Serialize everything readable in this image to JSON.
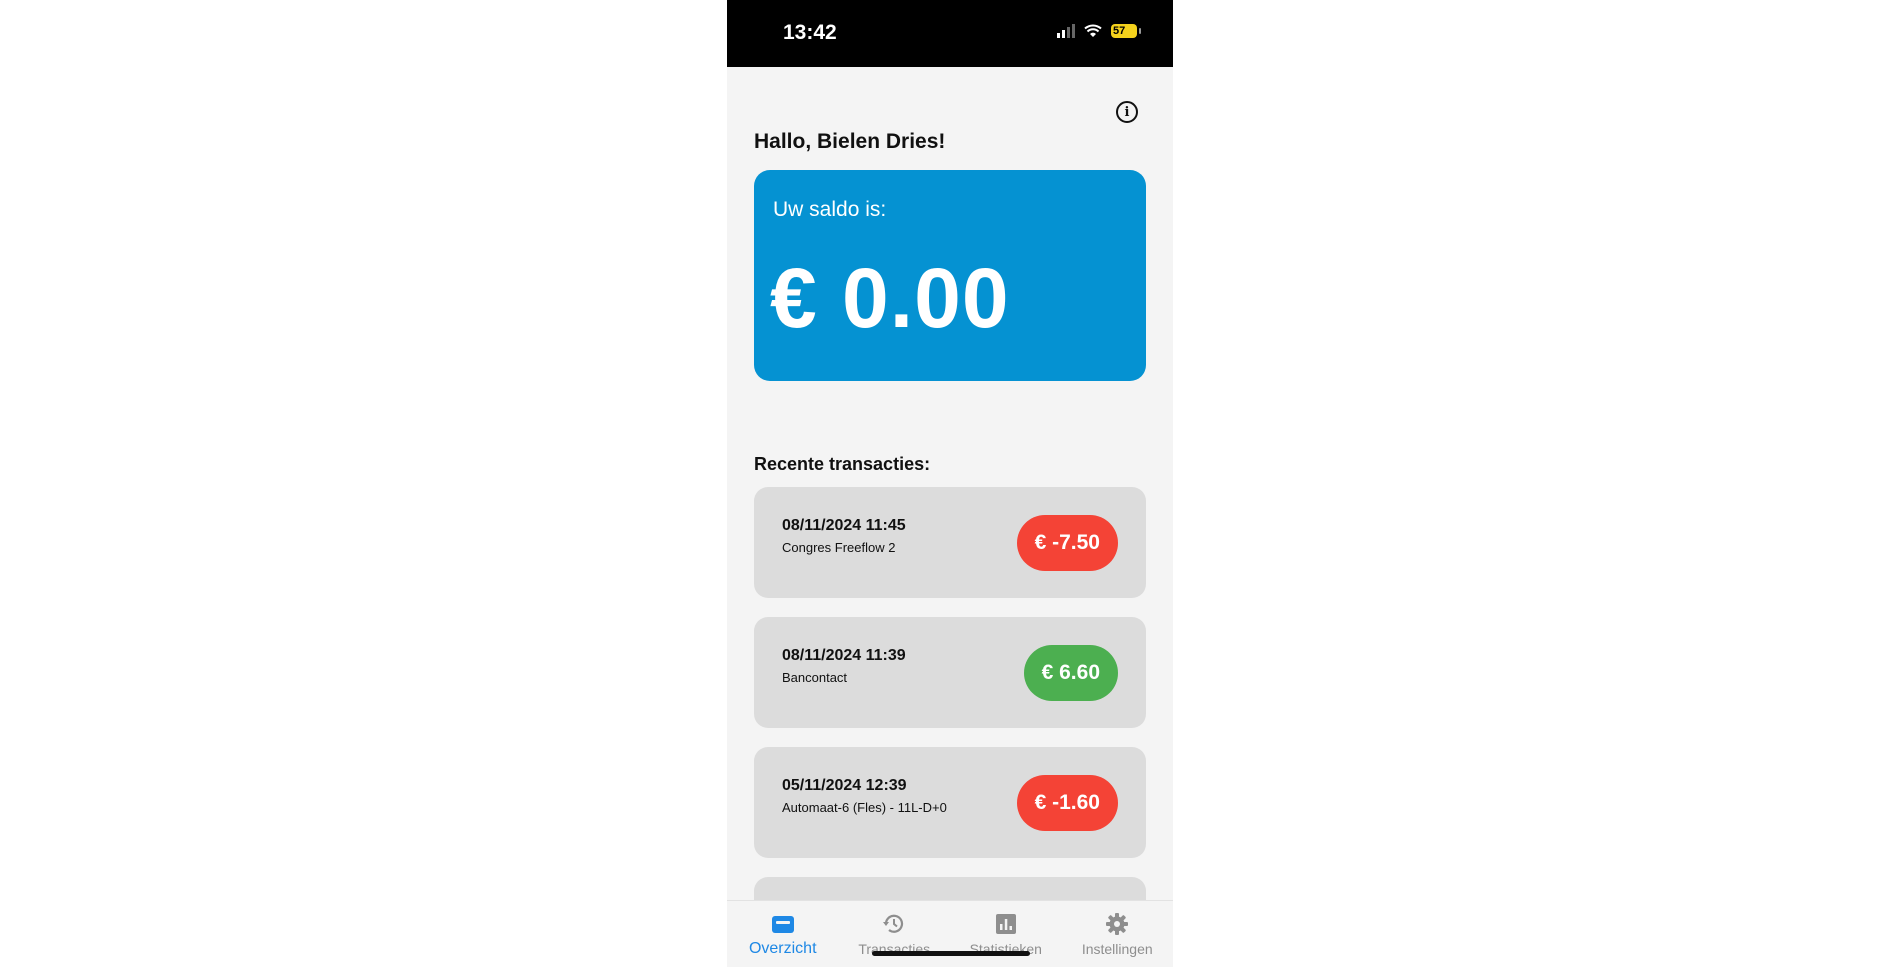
{
  "status_bar": {
    "time": "13:42",
    "battery": "57"
  },
  "greeting": "Hallo, Bielen Dries!",
  "balance": {
    "label": "Uw saldo is:",
    "amount": "€ 0.00",
    "color": "#0592d2"
  },
  "recent_title": "Recente transacties:",
  "transactions": [
    {
      "date": "08/11/2024 11:45",
      "description": "Congres Freeflow 2",
      "amount": "€ -7.50",
      "type": "negative"
    },
    {
      "date": "08/11/2024 11:39",
      "description": "Bancontact",
      "amount": "€ 6.60",
      "type": "positive"
    },
    {
      "date": "05/11/2024 12:39",
      "description": "Automaat-6 (Fles) - 11L-D+0",
      "amount": "€ -1.60",
      "type": "negative"
    }
  ],
  "tabs": [
    {
      "label": "Overzicht",
      "icon": "wallet-icon",
      "active": true
    },
    {
      "label": "Transacties",
      "icon": "history-icon",
      "active": false
    },
    {
      "label": "Statistieken",
      "icon": "chart-icon",
      "active": false
    },
    {
      "label": "Instellingen",
      "icon": "gear-icon",
      "active": false
    }
  ],
  "colors": {
    "negative": "#f44336",
    "positive": "#4caf50",
    "active_tab": "#1e88e5"
  }
}
